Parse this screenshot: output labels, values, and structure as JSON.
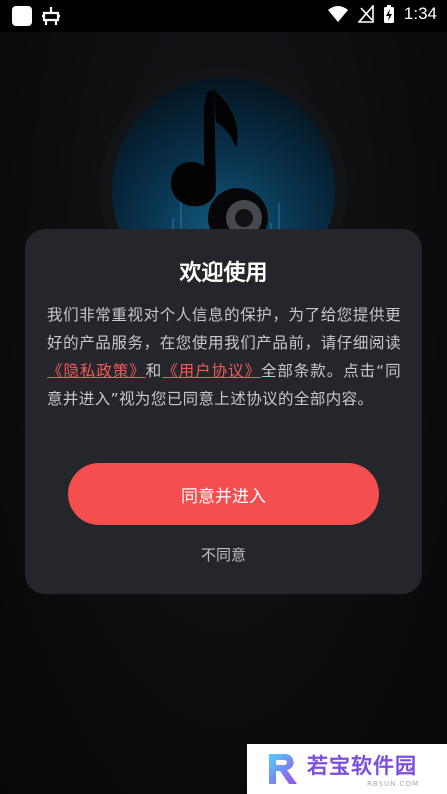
{
  "status_bar": {
    "time": "1:34",
    "icons": [
      "app-square-icon",
      "bug-icon",
      "wifi-icon",
      "no-signal-icon",
      "battery-charging-icon"
    ]
  },
  "dialog": {
    "title": "欢迎使用",
    "body_before": "我们非常重视对个人信息的保护，为了给您提供更好的产品服务，在您使用我们产品前，请仔细阅读",
    "privacy_link": "《隐私政策》",
    "and_text": "和",
    "terms_link": "《用户协议》",
    "body_after": "全部条款。点击“同意并进入”视为您已同意上述协议的全部内容。",
    "agree_label": "同意并进入",
    "disagree_label": "不同意"
  },
  "watermark": {
    "text": "若宝软件园",
    "sub": "RBSUN.COM"
  },
  "colors": {
    "accent": "#f54e4e",
    "link": "#f15a5a",
    "dialog_bg": "#25262b",
    "page_bg": "#141518"
  }
}
